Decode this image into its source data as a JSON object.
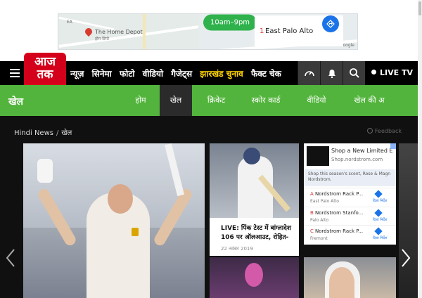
{
  "banner_ad": {
    "map_place": "The Home Depot",
    "map_place_sub": "होम डिपो",
    "map_place_left": "EA",
    "map_place_bottom": "Palo Alto",
    "hours": "10am–9pm",
    "result_number": "1",
    "result_city": "East Palo Alto",
    "attribution": "मैप डेटा ©2019 Google"
  },
  "logo": {
    "line1": "आज",
    "line2": "तक"
  },
  "nav": {
    "items": [
      "न्यूज़",
      "सिनेमा",
      "फोटो",
      "वीडियो",
      "गैजेट्स"
    ],
    "highlight": "झारखंड चुनाव",
    "last": "फैक्ट चेक",
    "live_label": "LIVE TV"
  },
  "sports": {
    "title": "खेल",
    "tabs": [
      "होम",
      "खेल",
      "क्रिकेट",
      "स्कोर कार्ड",
      "वीडियो",
      "खेल की अ"
    ],
    "active_tab": "खेल"
  },
  "breadcrumb": {
    "home": "Hindi News",
    "separator": "/",
    "current": "खेल"
  },
  "feedback_label": "Feedback",
  "cards": [
    {
      "title": "LIVE: पिंक टेस्ट में बांग्लादेश 106 पर ऑलआउट, रोहित-",
      "date": "22 नवंबर 2019"
    }
  ],
  "side_ad": {
    "headline": "Shop a New Limited E",
    "url": "Shop.nordstrom.com",
    "description_line1": "Shop this season's scent, Rose & Magn",
    "description_line2": "Nordstrom.",
    "locations": [
      {
        "num": "A",
        "name": "Nordstrom Rack P...",
        "city": "East Palo Alto",
        "dir": "दिशा निर्देश"
      },
      {
        "num": "B",
        "name": "Nordstrom Stanfo...",
        "city": "Palo Alto",
        "dir": "दिशा निर्देश"
      },
      {
        "num": "C",
        "name": "Nordstrom Rack P...",
        "city": "Fremont",
        "dir": "दिशा निर्देश"
      }
    ]
  },
  "colors": {
    "brand_red": "#d4001b",
    "sports_green": "#52b43c",
    "highlight_yellow": "#ffd400",
    "dark_bg": "#101010"
  },
  "icons": [
    "menu-icon",
    "speedometer-icon",
    "bell-icon",
    "search-icon",
    "live-dot-icon",
    "directions-icon",
    "chevron-left-icon",
    "chevron-right-icon",
    "feedback-icon"
  ]
}
